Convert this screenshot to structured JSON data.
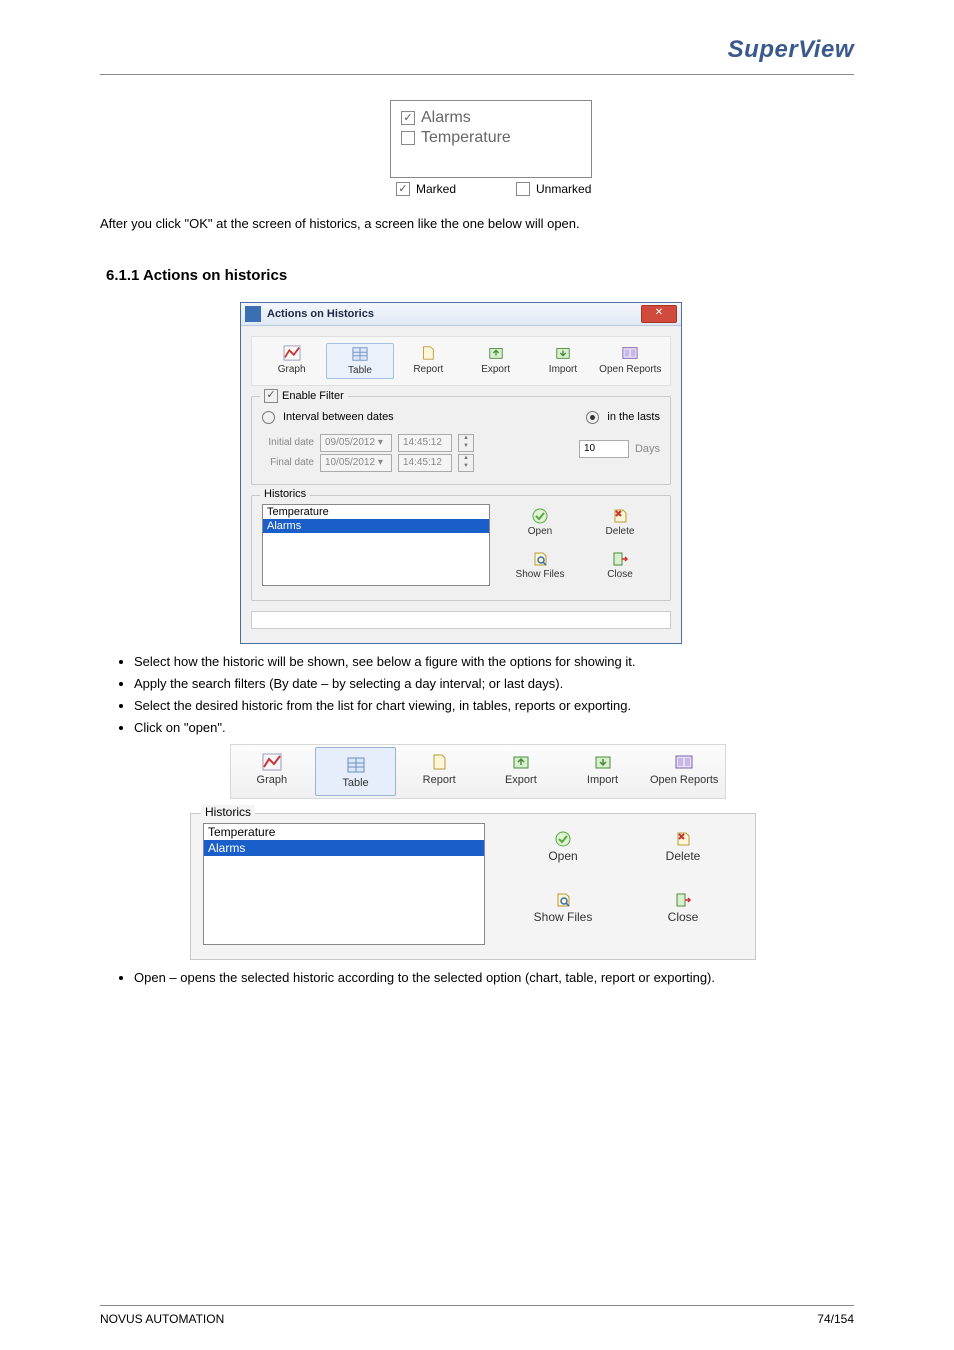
{
  "brand": "SuperView",
  "legend": {
    "items": [
      {
        "label": "Alarms",
        "checked": true
      },
      {
        "label": "Temperature",
        "checked": false
      }
    ],
    "marked": "Marked",
    "unmarked": "Unmarked"
  },
  "para_after_legend": "After you click \"OK\" at the screen of historics, a screen like the one below will open.",
  "section_title": "6.1.1  Actions on historics",
  "dialog": {
    "title": "Actions on Historics",
    "close_glyph": "✕",
    "toolbar": [
      {
        "key": "graph",
        "label": "Graph"
      },
      {
        "key": "table",
        "label": "Table"
      },
      {
        "key": "report",
        "label": "Report"
      },
      {
        "key": "export",
        "label": "Export"
      },
      {
        "key": "import",
        "label": "Import"
      },
      {
        "key": "openrep",
        "label": "Open Reports"
      }
    ],
    "filter": {
      "legend": "Enable Filter",
      "enable_checked": true,
      "interval_label": "Interval between dates",
      "interval_selected": false,
      "in_lasts_label": "in the lasts",
      "in_lasts_selected": true,
      "initial_label": "Initial date",
      "final_label": "Final date",
      "initial_date": "09/05/2012",
      "final_date": "10/05/2012",
      "initial_time": "14:45:12",
      "final_time": "14:45:12",
      "lasts_value": "10",
      "lasts_unit": "Days"
    },
    "historics": {
      "legend": "Historics",
      "items": [
        "Temperature",
        "Alarms"
      ],
      "selected_index": 1,
      "buttons": {
        "open": "Open",
        "delete": "Delete",
        "show_files": "Show Files",
        "close": "Close"
      }
    }
  },
  "bullets": [
    "Select how the historic will be shown, see below a figure with the options for showing it.",
    "Apply the search filters (By date – by selecting a day interval; or last days).",
    "Select the desired historic from the list for chart viewing, in tables, reports or exporting.",
    "Click on \"open\"."
  ],
  "bullet_open": "Open – opens the selected historic according to the selected option (chart, table, report or exporting).",
  "big_historics": {
    "legend": "Historics",
    "items": [
      "Temperature",
      "Alarms"
    ],
    "selected_index": 1,
    "buttons": {
      "open": "Open",
      "delete": "Delete",
      "show_files": "Show Files",
      "close": "Close"
    }
  },
  "footer": {
    "left": "NOVUS AUTOMATION",
    "right": "74/154"
  }
}
